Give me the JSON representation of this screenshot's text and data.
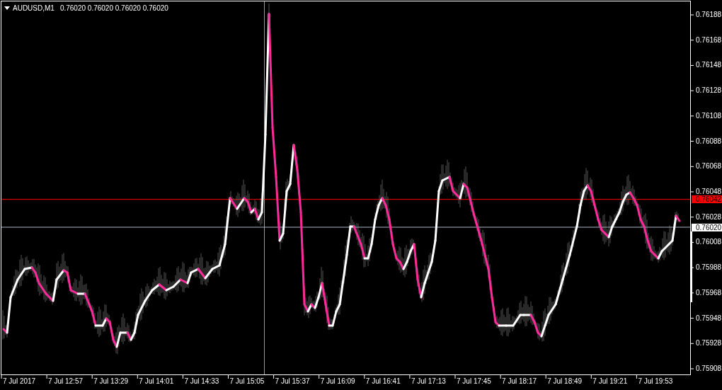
{
  "header": {
    "symbol": "AUDUSD,M1",
    "quotes": "0.76020 0.76020 0.76020 0.76020"
  },
  "price_axis": [
    "0.76188",
    "0.76168",
    "0.76148",
    "0.76128",
    "0.76108",
    "0.76088",
    "0.76068",
    "0.76048",
    "0.76028",
    "0.76008",
    "0.75988",
    "0.75968",
    "0.75948",
    "0.75928",
    "0.75908"
  ],
  "price_markers": [
    {
      "kind": "ask",
      "label": "0.76042"
    },
    {
      "kind": "bid",
      "label": "0.76020"
    }
  ],
  "time_axis": [
    "7 Jul 2017",
    "7 Jul 12:57",
    "7 Jul 13:29",
    "7 Jul 14:01",
    "7 Jul 14:33",
    "7 Jul 15:05",
    "7 Jul 15:37",
    "7 Jul 16:09",
    "7 Jul 16:41",
    "7 Jul 17:13",
    "7 Jul 17:45",
    "7 Jul 18:17",
    "7 Jul 18:49",
    "7 Jul 19:21",
    "7 Jul 19:53"
  ]
}
